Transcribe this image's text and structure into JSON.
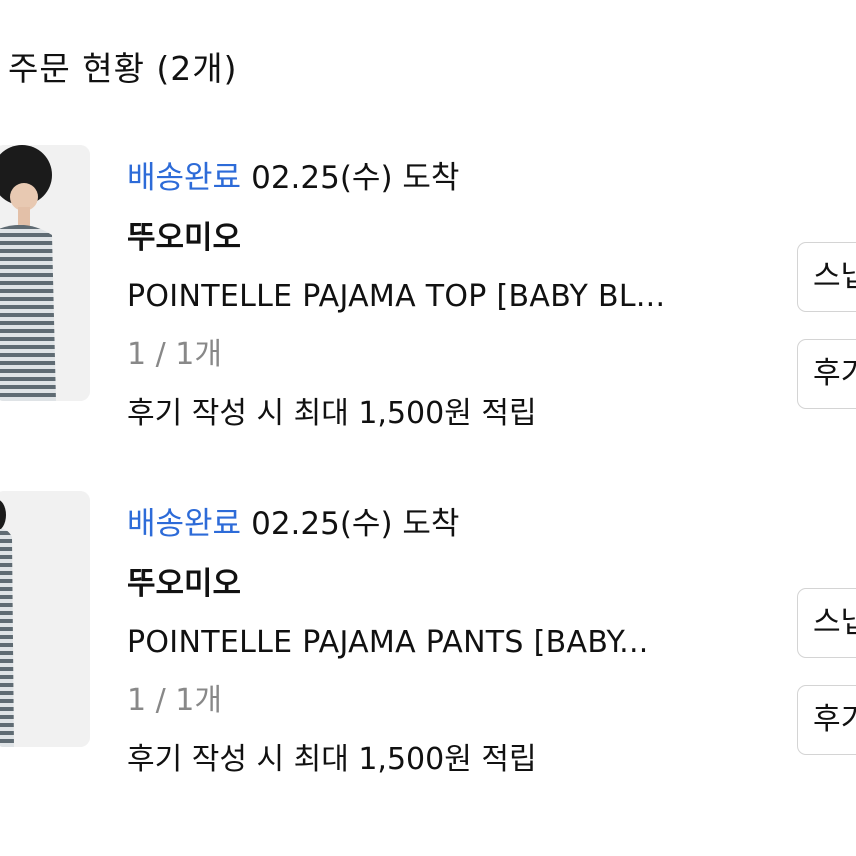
{
  "page": {
    "title": "주문 현황 (2개)"
  },
  "orders": [
    {
      "status": "배송완료",
      "arrival": "02.25(수) 도착",
      "brand": "뚜오미오",
      "product_name": "POINTELLE PAJAMA TOP [BABY BL...",
      "quantity": "1 / 1개",
      "review_reward": "후기 작성 시 최대 1,500원 적립",
      "button_primary": "스냅",
      "button_secondary": "후기"
    },
    {
      "status": "배송완료",
      "arrival": "02.25(수) 도착",
      "brand": "뚜오미오",
      "product_name": "POINTELLE PAJAMA PANTS [BABY...",
      "quantity": "1 / 1개",
      "review_reward": "후기 작성 시 최대 1,500원 적립",
      "button_primary": "스냅",
      "button_secondary": "후기"
    }
  ],
  "colors": {
    "status_accent": "#2d6bd8",
    "muted_text": "#888888",
    "button_border": "#d4d4d4",
    "thumb_background": "#f1f1f1"
  }
}
